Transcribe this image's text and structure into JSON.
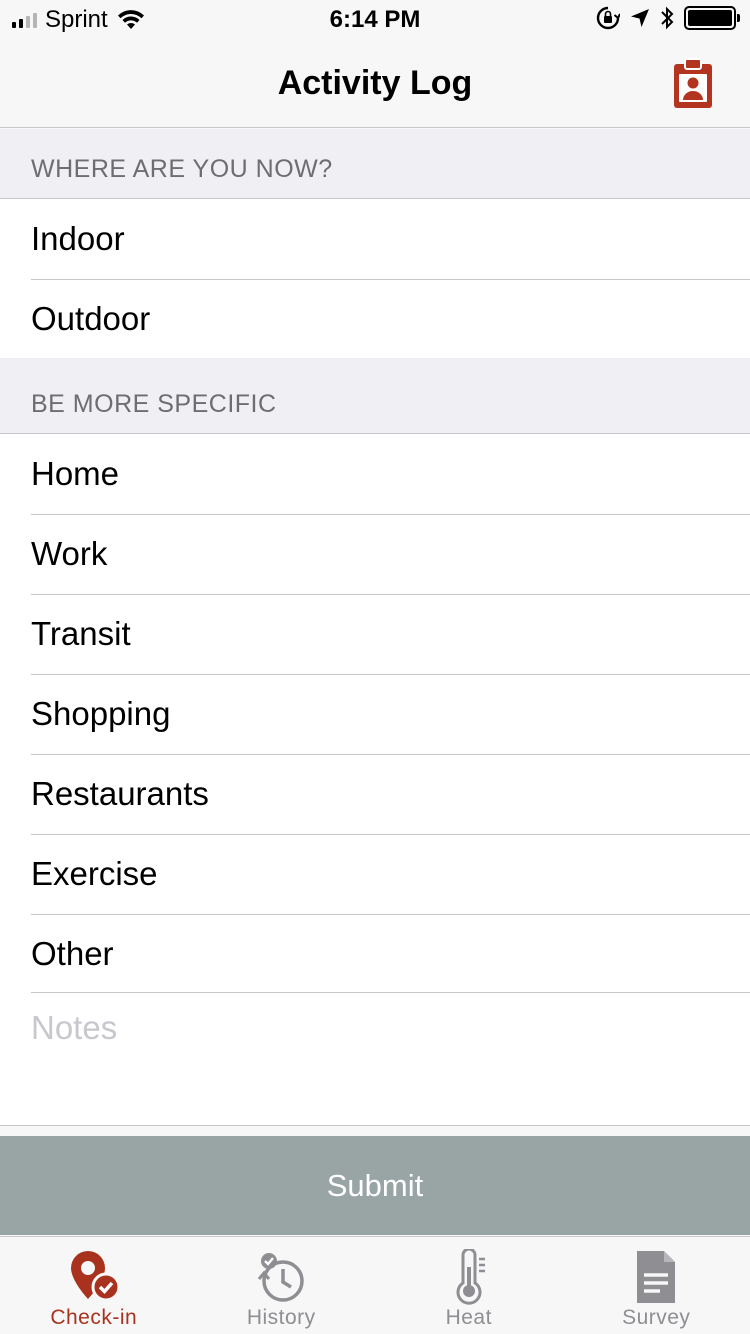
{
  "status": {
    "carrier": "Sprint",
    "time": "6:14 PM"
  },
  "nav": {
    "title": "Activity Log",
    "action_icon": "contact-badge-icon"
  },
  "sections": [
    {
      "header": "WHERE ARE YOU NOW?",
      "items": [
        "Indoor",
        "Outdoor"
      ]
    },
    {
      "header": "BE MORE SPECIFIC",
      "items": [
        "Home",
        "Work",
        "Transit",
        "Shopping",
        "Restaurants",
        "Exercise",
        "Other"
      ]
    }
  ],
  "notes": {
    "placeholder": "Notes"
  },
  "submit_label": "Submit",
  "tabs": [
    {
      "label": "Check-in",
      "icon": "map-pin-check-icon",
      "active": true
    },
    {
      "label": "History",
      "icon": "clock-history-icon",
      "active": false
    },
    {
      "label": "Heat",
      "icon": "thermometer-icon",
      "active": false
    },
    {
      "label": "Survey",
      "icon": "document-icon",
      "active": false
    }
  ],
  "colors": {
    "accent": "#a8321e",
    "submit_bg": "#99a4a4",
    "inactive": "#8e8e93"
  }
}
